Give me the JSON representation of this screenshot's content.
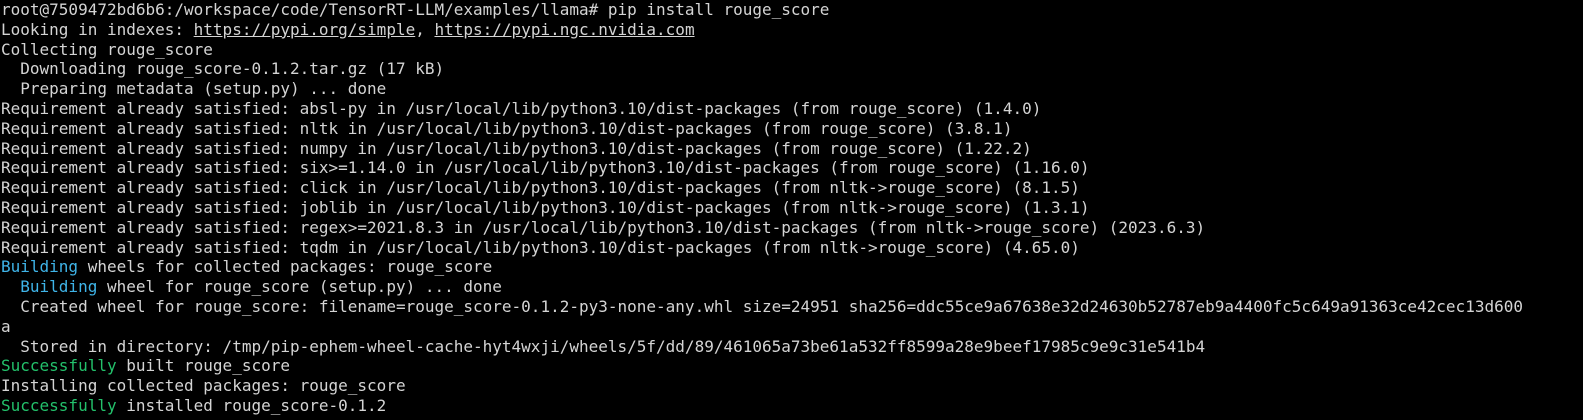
{
  "colors": {
    "background": "#000000",
    "text": "#d4d4d4",
    "building": "#3fb4e8",
    "success": "#23c16b"
  },
  "lines": {
    "l0": "root@7509472bd6b6:/workspace/code/TensorRT-LLM/examples/llama# pip install rouge_score",
    "l1_prefix": "Looking in indexes: ",
    "l1_url1": "https://pypi.org/simple",
    "l1_sep": ", ",
    "l1_url2": "https://pypi.ngc.nvidia.com",
    "l2": "Collecting rouge_score",
    "l3": "  Downloading rouge_score-0.1.2.tar.gz (17 kB)",
    "l4": "  Preparing metadata (setup.py) ... done",
    "l5": "Requirement already satisfied: absl-py in /usr/local/lib/python3.10/dist-packages (from rouge_score) (1.4.0)",
    "l6": "Requirement already satisfied: nltk in /usr/local/lib/python3.10/dist-packages (from rouge_score) (3.8.1)",
    "l7": "Requirement already satisfied: numpy in /usr/local/lib/python3.10/dist-packages (from rouge_score) (1.22.2)",
    "l8": "Requirement already satisfied: six>=1.14.0 in /usr/local/lib/python3.10/dist-packages (from rouge_score) (1.16.0)",
    "l9": "Requirement already satisfied: click in /usr/local/lib/python3.10/dist-packages (from nltk->rouge_score) (8.1.5)",
    "l10": "Requirement already satisfied: joblib in /usr/local/lib/python3.10/dist-packages (from nltk->rouge_score) (1.3.1)",
    "l11": "Requirement already satisfied: regex>=2021.8.3 in /usr/local/lib/python3.10/dist-packages (from nltk->rouge_score) (2023.6.3)",
    "l12": "Requirement already satisfied: tqdm in /usr/local/lib/python3.10/dist-packages (from nltk->rouge_score) (4.65.0)",
    "l13_hl": "Building",
    "l13_rest": " wheels for collected packages: rouge_score",
    "l14_indent": "  ",
    "l14_hl": "Building",
    "l14_rest": " wheel for rouge_score (setup.py) ... done",
    "l15": "  Created wheel for rouge_score: filename=rouge_score-0.1.2-py3-none-any.whl size=24951 sha256=ddc55ce9a67638e32d24630b52787eb9a4400fc5c649a91363ce42cec13d600",
    "l16": "a",
    "l17": "  Stored in directory: /tmp/pip-ephem-wheel-cache-hyt4wxji/wheels/5f/dd/89/461065a73be61a532ff8599a28e9beef17985c9e9c31e541b4",
    "l18_hl": "Successfully",
    "l18_rest": " built rouge_score",
    "l19": "Installing collected packages: rouge_score",
    "l20_hl": "Successfully",
    "l20_rest": " installed rouge_score-0.1.2"
  }
}
